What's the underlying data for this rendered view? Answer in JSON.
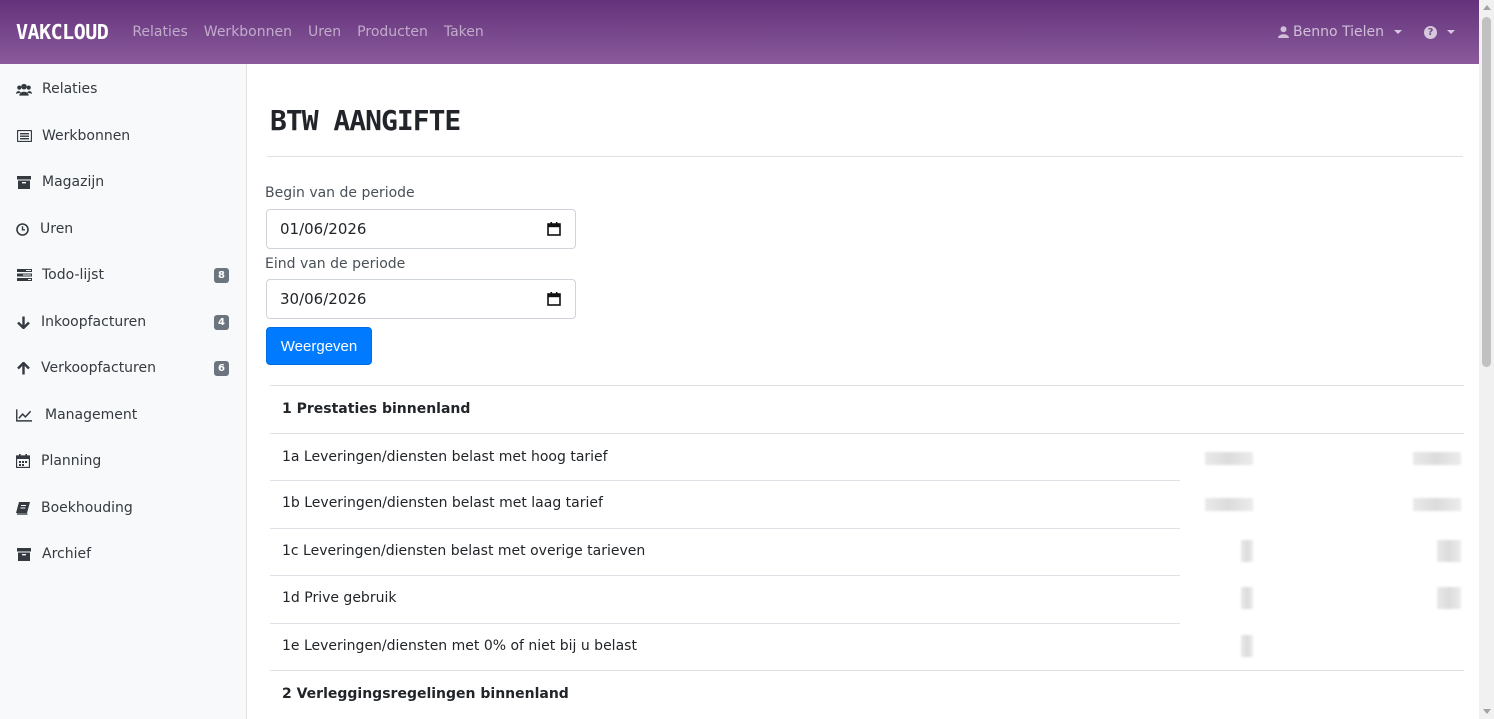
{
  "app": {
    "brand": "VAKCLOUD",
    "nav": [
      "Relaties",
      "Werkbonnen",
      "Uren",
      "Producten",
      "Taken"
    ],
    "user": "Benno Tielen",
    "accent": "#63327a"
  },
  "sidebar": {
    "items": [
      {
        "label": "Relaties",
        "icon": "users-icon"
      },
      {
        "label": "Werkbonnen",
        "icon": "list-alt-icon"
      },
      {
        "label": "Magazijn",
        "icon": "archive-icon"
      },
      {
        "label": "Uren",
        "icon": "clock-icon"
      },
      {
        "label": "Todo-lijst",
        "icon": "tasks-icon",
        "badge": "8"
      },
      {
        "label": "Inkoopfacturen",
        "icon": "arrow-down-icon",
        "badge": "4"
      },
      {
        "label": "Verkoopfacturen",
        "icon": "arrow-up-icon",
        "badge": "6"
      },
      {
        "label": "Management",
        "icon": "line-chart-icon"
      },
      {
        "label": "Planning",
        "icon": "calendar-icon"
      },
      {
        "label": "Boekhouding",
        "icon": "book-icon"
      },
      {
        "label": "Archief",
        "icon": "archive-icon"
      }
    ]
  },
  "page": {
    "title": "BTW AANGIFTE",
    "begin_label": "Begin van de periode",
    "begin_value": "01/06/2026",
    "end_label": "Eind van de periode",
    "end_value": "30/06/2026",
    "submit_label": "Weergeven"
  },
  "table": {
    "rows": [
      {
        "type": "section",
        "text": "1 Prestaties binnenland"
      },
      {
        "type": "sub",
        "text": "1a Leveringen/diensten belast met hoog tarief"
      },
      {
        "type": "sub",
        "text": "1b Leveringen/diensten belast met laag tarief"
      },
      {
        "type": "sub",
        "text": "1c Leveringen/diensten belast met overige tarieven"
      },
      {
        "type": "sub",
        "text": "1d Prive gebruik"
      },
      {
        "type": "sub",
        "text": "1e Leveringen/diensten met 0% of niet bij u belast"
      },
      {
        "type": "section",
        "text": "2 Verleggingsregelingen binnenland"
      }
    ]
  }
}
